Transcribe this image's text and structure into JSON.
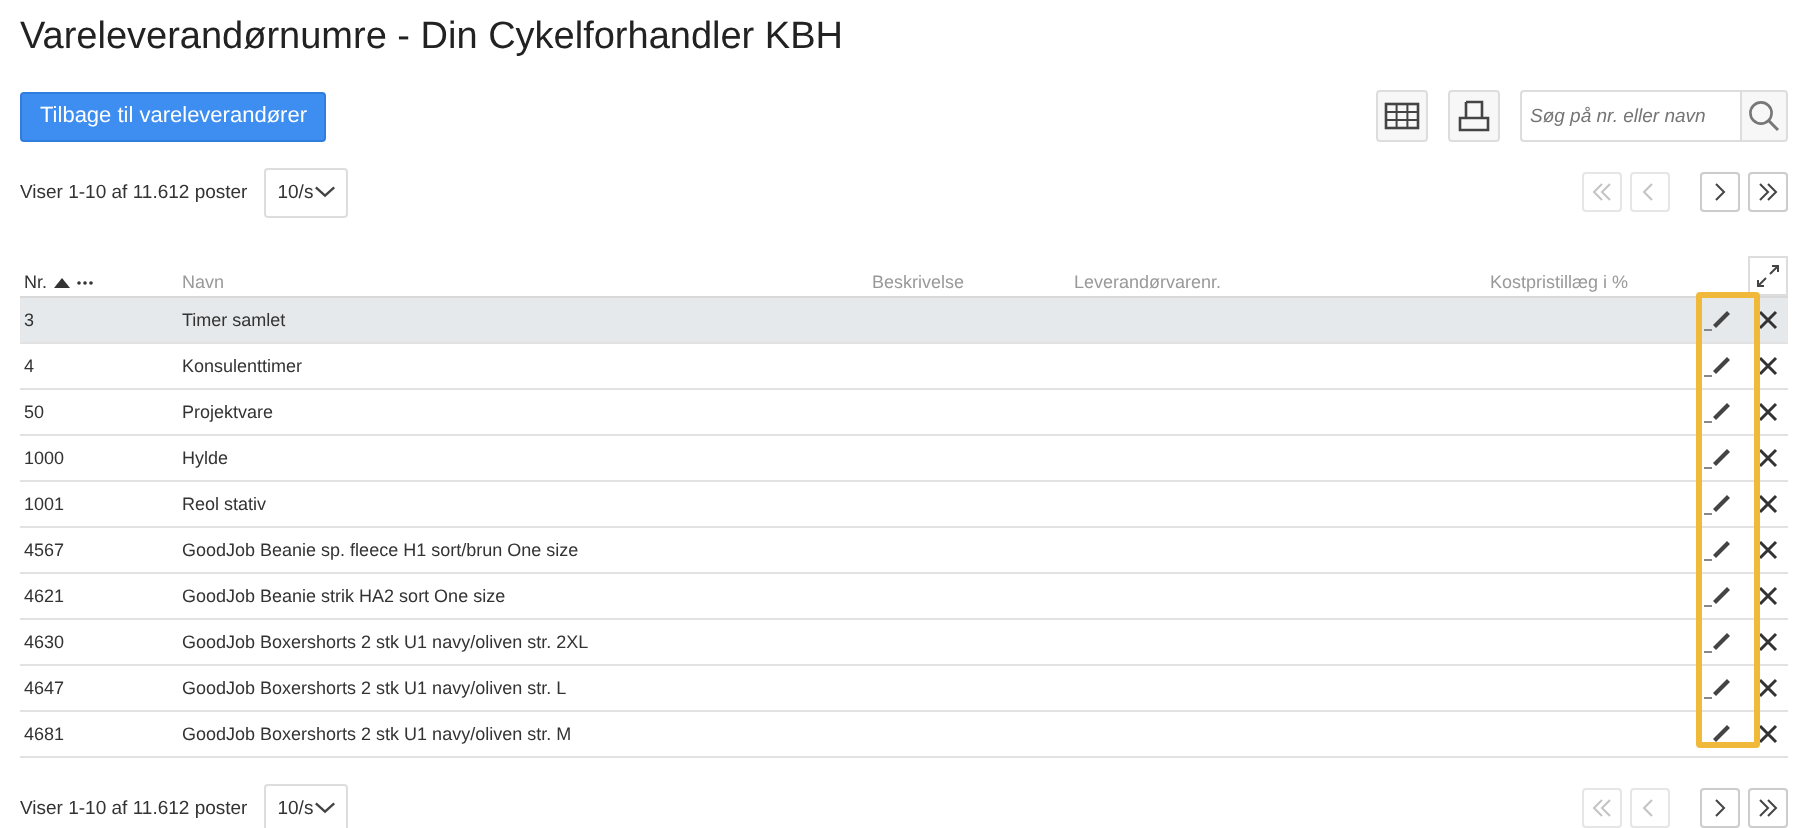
{
  "page_title": "Vareleverandørnumre - Din Cykelforhandler KBH",
  "back_button": "Tilbage til vareleverandører",
  "search": {
    "placeholder": "Søg på nr. eller navn"
  },
  "top_pager": {
    "summary": "Viser 1-10 af 11.612 poster",
    "page_size": "10/s",
    "buttons": [
      {
        "kind": "first",
        "disabled": true
      },
      {
        "kind": "prev",
        "disabled": true
      },
      {
        "kind": "next",
        "disabled": false
      },
      {
        "kind": "last",
        "disabled": false
      }
    ]
  },
  "table": {
    "columns": [
      {
        "label": "Nr.",
        "sorted": true
      },
      {
        "label": "Navn",
        "sorted": false
      },
      {
        "label": "Beskrivelse",
        "sorted": false
      },
      {
        "label": "Leverandørvarenr.",
        "sorted": false
      },
      {
        "label": "Kostpristillæg i %",
        "sorted": false
      }
    ],
    "rows": [
      {
        "nr": "3",
        "name": "Timer samlet",
        "selected": true
      },
      {
        "nr": "4",
        "name": "Konsulenttimer",
        "selected": false
      },
      {
        "nr": "50",
        "name": "Projektvare",
        "selected": false
      },
      {
        "nr": "1000",
        "name": "Hylde",
        "selected": false
      },
      {
        "nr": "1001",
        "name": "Reol stativ",
        "selected": false
      },
      {
        "nr": "4567",
        "name": "GoodJob Beanie sp. fleece H1 sort/brun One size",
        "selected": false
      },
      {
        "nr": "4621",
        "name": "GoodJob Beanie strik HA2 sort One size",
        "selected": false
      },
      {
        "nr": "4630",
        "name": "GoodJob Boxershorts 2 stk U1 navy/oliven str. 2XL",
        "selected": false
      },
      {
        "nr": "4647",
        "name": "GoodJob Boxershorts 2 stk U1 navy/oliven str. L",
        "selected": false
      },
      {
        "nr": "4681",
        "name": "GoodJob Boxershorts 2 stk U1 navy/oliven str. M",
        "selected": false
      }
    ]
  },
  "bottom_pager": {
    "summary": "Viser 1-10 af 11.612 poster",
    "page_size": "10/s",
    "buttons": [
      {
        "kind": "first",
        "disabled": true
      },
      {
        "kind": "prev",
        "disabled": true
      },
      {
        "kind": "next",
        "disabled": false
      },
      {
        "kind": "last",
        "disabled": false
      }
    ]
  }
}
